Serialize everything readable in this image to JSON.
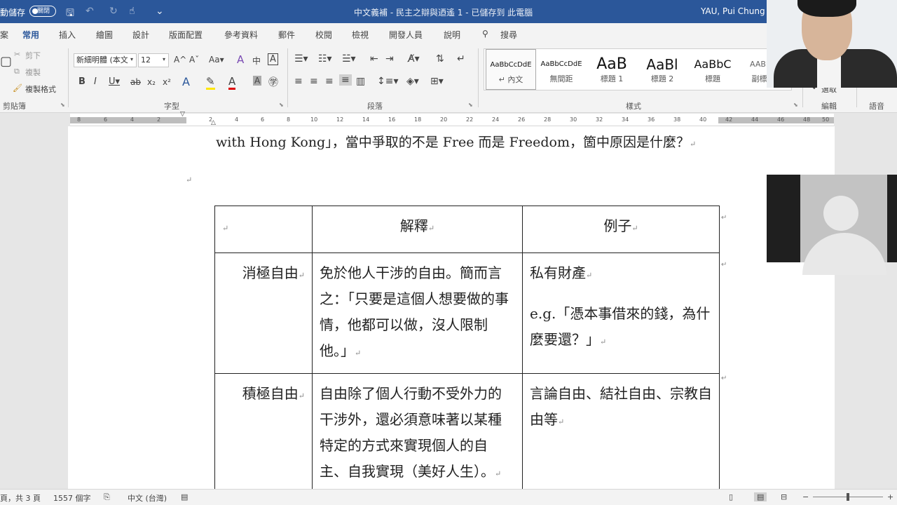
{
  "titlebar": {
    "autosave": "動儲存",
    "autosave_toggle": "關閉",
    "doc_title": "中文義補 - 民主之辯與迺遙 1 - 已儲存到 此電腦",
    "user": "YAU, Pui Chung"
  },
  "tabs": [
    "常用",
    "插入",
    "繪圖",
    "設計",
    "版面配置",
    "參考資料",
    "郵件",
    "校閱",
    "檢視",
    "開發人員",
    "說明"
  ],
  "search_label": "搜尋",
  "ribbon": {
    "clipboard": {
      "cut": "剪下",
      "copy": "複製",
      "format_painter": "複製格式",
      "label": "剪貼簿"
    },
    "font": {
      "name": "新細明體 (本文",
      "size": "12",
      "label": "字型"
    },
    "paragraph_label": "段落",
    "styles_label": "樣式",
    "styles": [
      {
        "preview": "AaBbCcDdE",
        "name": "↵ 內文"
      },
      {
        "preview": "AaBbCcDdE",
        "name": "無間距"
      },
      {
        "preview": "AaB",
        "name": "標題 1"
      },
      {
        "preview": "AaBl",
        "name": "標題 2"
      },
      {
        "preview": "AaBbC",
        "name": "標題"
      },
      {
        "preview": "AABBC",
        "name": "副標題"
      }
    ],
    "select_label": "選取",
    "editing_label": "編輯",
    "voice_label": "語音"
  },
  "ruler_ticks": [
    "8",
    "6",
    "4",
    "2",
    "2",
    "4",
    "6",
    "8",
    "10",
    "12",
    "14",
    "16",
    "18",
    "20",
    "22",
    "24",
    "26",
    "28",
    "30",
    "32",
    "34",
    "36",
    "38",
    "40",
    "42",
    "44",
    "46",
    "48",
    "50"
  ],
  "document": {
    "intro_line": "with Hong Kong」，當中爭取的不是 Free 而是 Freedom，箇中原因是什麼？",
    "table": {
      "header": [
        "",
        "解釋",
        "例子"
      ],
      "rows": [
        {
          "term": "消極自由",
          "explanation": "免於他人干涉的自由。簡而言之：「只要是這個人想要做的事情，他都可以做，沒人限制他。」",
          "example_1": "私有財產",
          "example_2": "e.g.「憑本事借來的錢，為什麼要還？」"
        },
        {
          "term": "積極自由",
          "explanation": "自由除了個人行動不受外力的干涉外，還必須意味著以某種特定的方式來實現個人的自主、自我實現（美好人生）。",
          "example_1": "言論自由、結社自由、宗教自由等",
          "example_2": ""
        }
      ]
    }
  },
  "status": {
    "pages": "頁，共 3 頁",
    "words": "1557 個字",
    "language": "中文 (台灣)"
  }
}
